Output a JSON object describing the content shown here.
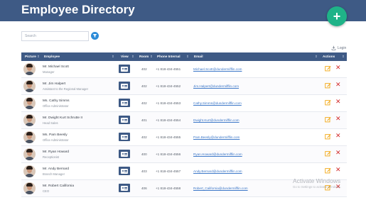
{
  "header": {
    "title": "Employee Directory",
    "add_button_label": "+"
  },
  "search": {
    "placeholder": "Search"
  },
  "login": {
    "label": "Login"
  },
  "table": {
    "columns": [
      {
        "label": "Picture",
        "sort": "⇕"
      },
      {
        "label": "Employee",
        "sort": "⇕"
      },
      {
        "label": "View",
        "sort": "⇕"
      },
      {
        "label": "Room",
        "sort": "⇕"
      },
      {
        "label": "Phone Internal",
        "sort": "⇕"
      },
      {
        "label": "Email",
        "sort": "⇕"
      },
      {
        "label": "Actions",
        "sort": "⇕"
      }
    ],
    "rows": [
      {
        "name": "Mr. Michael Scott",
        "role": "Manager",
        "room": "402",
        "phone": "+1 818-434-4551",
        "email": "Michael.Scott@dundermifflin.com"
      },
      {
        "name": "Mr. Jim Halpert",
        "role": "Assistant to the Regional Manager",
        "room": "402",
        "phone": "+1 818-434-4552",
        "email": "Jim.Halpert@dundermifflin.com"
      },
      {
        "name": "Ms. Cathy Simms",
        "role": "Office Administrator",
        "room": "402",
        "phone": "+1 818-434-4553",
        "email": "Cathy.Simms@dundermifflin.com"
      },
      {
        "name": "Mr. Dwight Kurt Schrutte II",
        "role": "Head Sales",
        "room": "401",
        "phone": "+1 818-434-4554",
        "email": "Dwight.Kurt@dundermifflin.com"
      },
      {
        "name": "Ms. Pam Beesly",
        "role": "Office Administrator",
        "room": "402",
        "phone": "+1 818-434-4555",
        "email": "Pam.Beesly@dundermifflin.com"
      },
      {
        "name": "Mr. Ryan Howard",
        "role": "Receptionist",
        "room": "400",
        "phone": "+1 818-434-4556",
        "email": "Ryan.Howard@dundermifflin.com"
      },
      {
        "name": "Mr. Andy Bernard",
        "role": "Branch Manager",
        "room": "403",
        "phone": "+1 818-434-4557",
        "email": "Andy.Bernard@dundermifflin.com"
      },
      {
        "name": "Mr. Robert California",
        "role": "CEO",
        "room": "406",
        "phone": "+1 818-434-4558",
        "email": "Robert_California@dundermifflin.com"
      }
    ]
  },
  "watermark": {
    "title": "Activate Windows",
    "subtitle": "Go to Settings to activate Windows."
  },
  "colors": {
    "header_bg": "#3e5a85",
    "add_button": "#1fb388",
    "filter_button": "#2d8cd8",
    "edit_icon": "#f2a712",
    "delete_icon": "#d22b2b",
    "email_link": "#3d78c8"
  },
  "icons": {
    "add": "plus-icon",
    "filter": "filter-icon",
    "login": "download-icon",
    "view": "id-card-icon",
    "edit": "edit-icon",
    "delete": "close-icon"
  }
}
